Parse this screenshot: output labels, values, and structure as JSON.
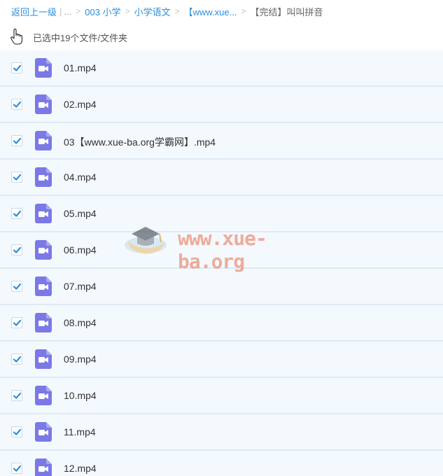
{
  "breadcrumb": {
    "back": "返回上一级",
    "ellipsis": "...",
    "items": [
      "003 小学",
      "小学语文",
      "【www.xue..."
    ],
    "current": "【完结】叫叫拼音",
    "separator": ">"
  },
  "selection": {
    "text": "已选中19个文件/文件夹"
  },
  "files": [
    {
      "name": "01.mp4",
      "checked": true
    },
    {
      "name": "02.mp4",
      "checked": true
    },
    {
      "name": "03【www.xue-ba.org学霸网】.mp4",
      "checked": true
    },
    {
      "name": "04.mp4",
      "checked": true
    },
    {
      "name": "05.mp4",
      "checked": true
    },
    {
      "name": "06.mp4",
      "checked": true
    },
    {
      "name": "07.mp4",
      "checked": true
    },
    {
      "name": "08.mp4",
      "checked": true
    },
    {
      "name": "09.mp4",
      "checked": true
    },
    {
      "name": "10.mp4",
      "checked": true
    },
    {
      "name": "11.mp4",
      "checked": true
    },
    {
      "name": "12.mp4",
      "checked": true
    }
  ],
  "watermark": {
    "text": "www.xue-ba.org"
  },
  "colors": {
    "link": "#2a8fdc",
    "check": "#2a8fdc",
    "video_icon": "#7a79e6",
    "row_bg": "#f4f9fe"
  }
}
